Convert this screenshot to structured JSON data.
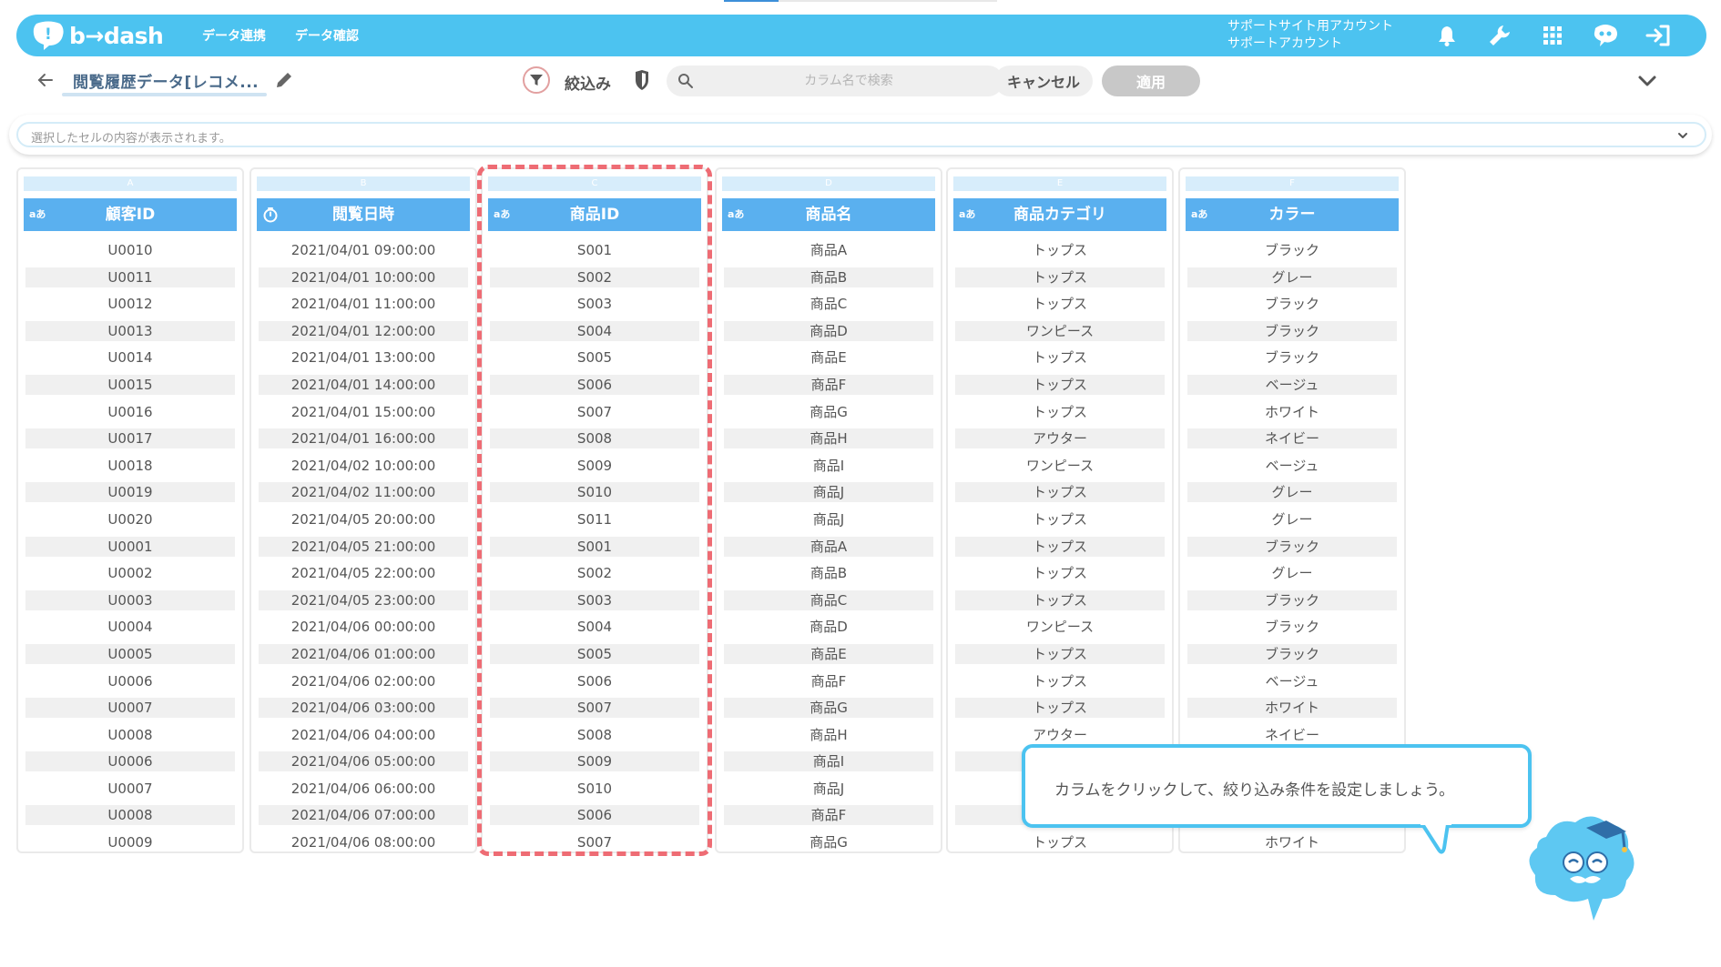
{
  "header": {
    "logo_text": "b→dash",
    "nav": [
      "データ連携",
      "データ確認"
    ],
    "account_line1": "サポートサイト用アカウント",
    "account_line2": "サポートアカウント",
    "icons": [
      "bell-icon",
      "wrench-icon",
      "grid-icon",
      "chat-bot-icon",
      "logout-icon"
    ]
  },
  "toolbar": {
    "title": "閲覧履歴データ[レコメ...",
    "filter_label": "絞込み",
    "search_placeholder": "カラム名で検索",
    "cancel_label": "キャンセル",
    "apply_label": "適用"
  },
  "cellbar": {
    "placeholder": "選択したセルの内容が表示されます。"
  },
  "columns": [
    {
      "letter": "A",
      "type": "aあ",
      "name": "顧客ID",
      "cells": [
        "U0010",
        "U0011",
        "U0012",
        "U0013",
        "U0014",
        "U0015",
        "U0016",
        "U0017",
        "U0018",
        "U0019",
        "U0020",
        "U0001",
        "U0002",
        "U0003",
        "U0004",
        "U0005",
        "U0006",
        "U0007",
        "U0008",
        "U0006",
        "U0007",
        "U0008",
        "U0009"
      ]
    },
    {
      "letter": "B",
      "type": "time",
      "name": "閲覧日時",
      "cells": [
        "2021/04/01 09:00:00",
        "2021/04/01 10:00:00",
        "2021/04/01 11:00:00",
        "2021/04/01 12:00:00",
        "2021/04/01 13:00:00",
        "2021/04/01 14:00:00",
        "2021/04/01 15:00:00",
        "2021/04/01 16:00:00",
        "2021/04/02 10:00:00",
        "2021/04/02 11:00:00",
        "2021/04/05 20:00:00",
        "2021/04/05 21:00:00",
        "2021/04/05 22:00:00",
        "2021/04/05 23:00:00",
        "2021/04/06 00:00:00",
        "2021/04/06 01:00:00",
        "2021/04/06 02:00:00",
        "2021/04/06 03:00:00",
        "2021/04/06 04:00:00",
        "2021/04/06 05:00:00",
        "2021/04/06 06:00:00",
        "2021/04/06 07:00:00",
        "2021/04/06 08:00:00"
      ]
    },
    {
      "letter": "C",
      "type": "aあ",
      "name": "商品ID",
      "cells": [
        "S001",
        "S002",
        "S003",
        "S004",
        "S005",
        "S006",
        "S007",
        "S008",
        "S009",
        "S010",
        "S011",
        "S001",
        "S002",
        "S003",
        "S004",
        "S005",
        "S006",
        "S007",
        "S008",
        "S009",
        "S010",
        "S006",
        "S007"
      ]
    },
    {
      "letter": "D",
      "type": "aあ",
      "name": "商品名",
      "cells": [
        "商品A",
        "商品B",
        "商品C",
        "商品D",
        "商品E",
        "商品F",
        "商品G",
        "商品H",
        "商品I",
        "商品J",
        "商品J",
        "商品A",
        "商品B",
        "商品C",
        "商品D",
        "商品E",
        "商品F",
        "商品G",
        "商品H",
        "商品I",
        "商品J",
        "商品F",
        "商品G"
      ]
    },
    {
      "letter": "E",
      "type": "aあ",
      "name": "商品カテゴリ",
      "cells": [
        "トップス",
        "トップス",
        "トップス",
        "ワンピース",
        "トップス",
        "トップス",
        "トップス",
        "アウター",
        "ワンピース",
        "トップス",
        "トップス",
        "トップス",
        "トップス",
        "トップス",
        "ワンピース",
        "トップス",
        "トップス",
        "トップス",
        "アウター",
        "",
        "",
        "",
        "トップス"
      ]
    },
    {
      "letter": "F",
      "type": "aあ",
      "name": "カラー",
      "cells": [
        "ブラック",
        "グレー",
        "ブラック",
        "ブラック",
        "ブラック",
        "ベージュ",
        "ホワイト",
        "ネイビー",
        "ベージュ",
        "グレー",
        "グレー",
        "ブラック",
        "グレー",
        "ブラック",
        "ブラック",
        "ブラック",
        "ベージュ",
        "ホワイト",
        "ネイビー",
        "",
        "",
        "",
        "ホワイト"
      ]
    }
  ],
  "tooltip": {
    "text": "カラムをクリックして、絞り込み条件を設定しましょう。"
  }
}
